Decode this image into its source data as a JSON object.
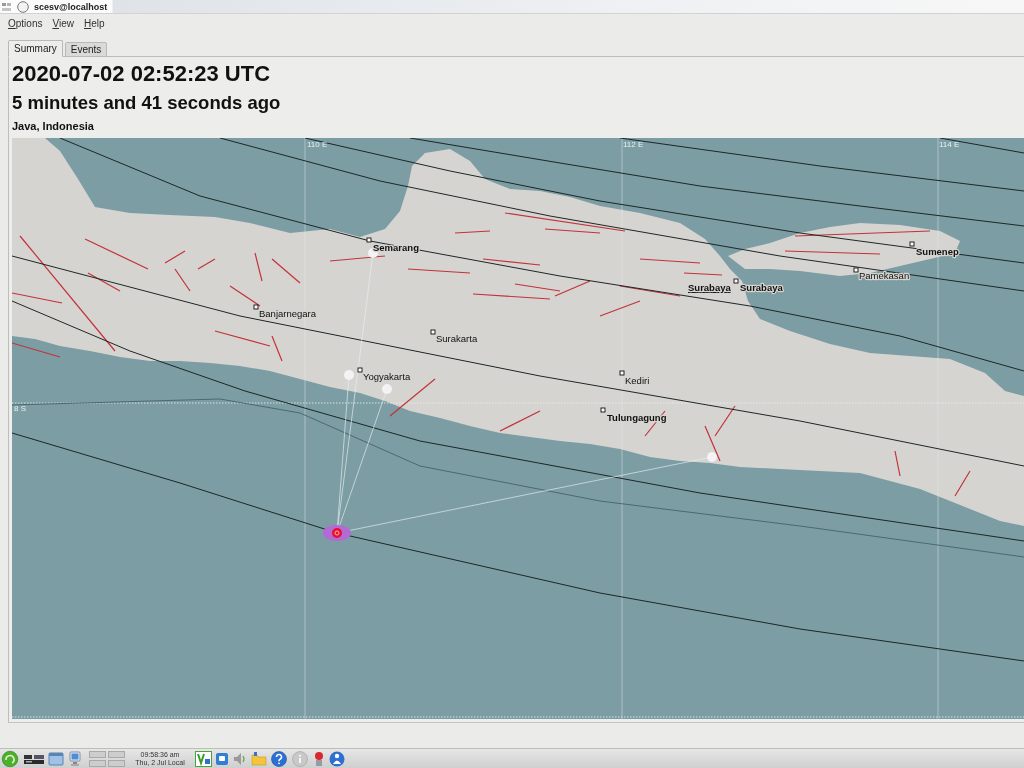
{
  "window": {
    "title": "scesv@localhost"
  },
  "menu": [
    {
      "label": "Options"
    },
    {
      "label": "View"
    },
    {
      "label": "Help"
    }
  ],
  "tabs": [
    {
      "label": "Summary",
      "selected": true
    },
    {
      "label": "Events",
      "selected": false
    }
  ],
  "summary": {
    "origin_time": "2020-07-02 02:52:23 UTC",
    "elapsed": "5 minutes and 41 seconds ago",
    "region": "Java, Indonesia"
  },
  "map": {
    "grid_labels": [
      "110 E",
      "112 E",
      "114 E",
      "8 S"
    ],
    "cities": [
      {
        "name": "Semarang",
        "kind": "major"
      },
      {
        "name": "Banjarnegara",
        "kind": "minor"
      },
      {
        "name": "Surakarta",
        "kind": "minor"
      },
      {
        "name": "Yogyakarta",
        "kind": "minor"
      },
      {
        "name": "Kediri",
        "kind": "minor"
      },
      {
        "name": "Tulungagung",
        "kind": "major"
      },
      {
        "name": "Surabaya",
        "kind": "capital"
      },
      {
        "name": "Surabaya",
        "kind": "major"
      },
      {
        "name": "Pamekasan",
        "kind": "minor"
      },
      {
        "name": "Sumenep",
        "kind": "major"
      }
    ]
  },
  "taskbar": {
    "clock_time": "09:58:36 am",
    "clock_date": "Thu, 2 Jul Local"
  }
}
